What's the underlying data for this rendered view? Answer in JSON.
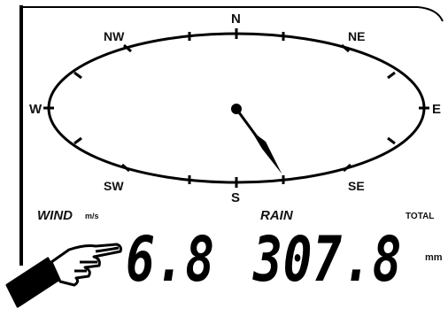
{
  "compass": {
    "N": "N",
    "NE": "NE",
    "E": "E",
    "SE": "SE",
    "S": "S",
    "SW": "SW",
    "W": "W",
    "NW": "NW",
    "needle_direction": "SSE"
  },
  "wind": {
    "label": "WIND",
    "unit": "m/s",
    "value": "6.8"
  },
  "rain": {
    "label": "RAIN",
    "total_label": "TOTAL",
    "value": "307.8",
    "unit": "mm"
  },
  "icons": {
    "pointer": "pointing-hand-icon",
    "needle": "wind-direction-needle-icon"
  },
  "colors": {
    "lcd_ink": "#000000",
    "background": "#ffffff"
  }
}
